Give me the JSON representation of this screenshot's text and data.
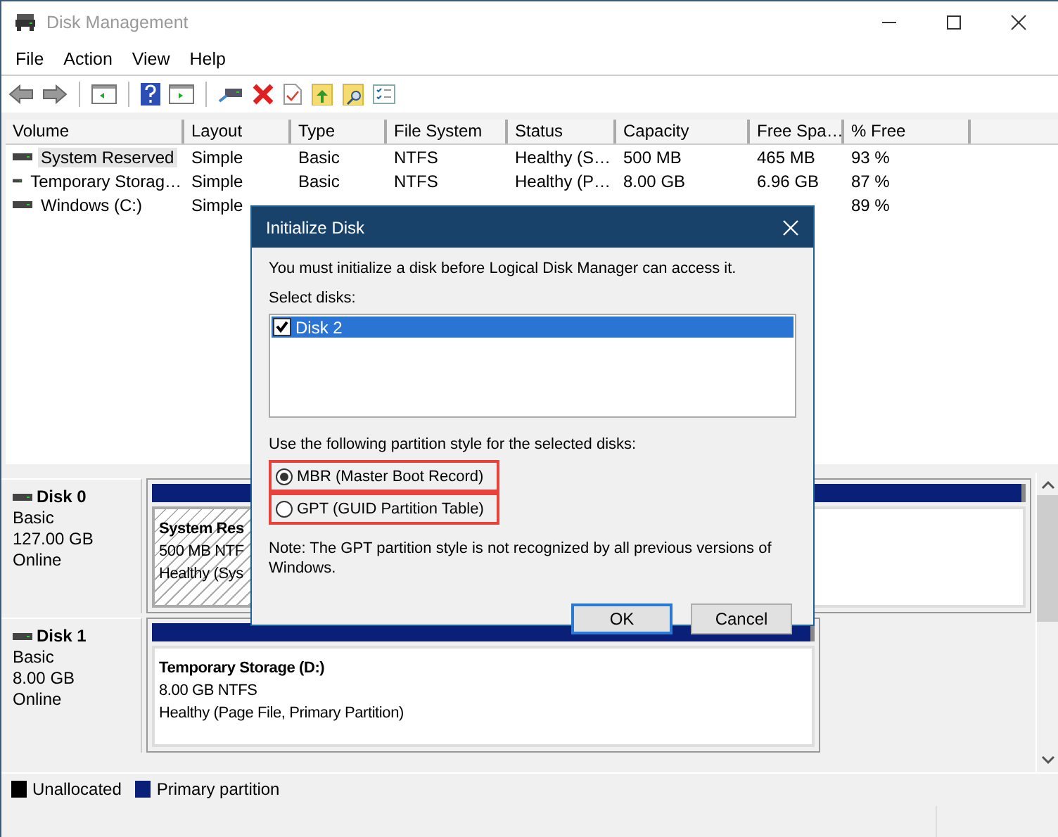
{
  "window": {
    "title": "Disk Management"
  },
  "menu": [
    "File",
    "Action",
    "View",
    "Help"
  ],
  "volume_table": {
    "columns": [
      "Volume",
      "Layout",
      "Type",
      "File System",
      "Status",
      "Capacity",
      "Free Spa…",
      "% Free"
    ],
    "rows": [
      {
        "selected": true,
        "volume": "System Reserved",
        "layout": "Simple",
        "type": "Basic",
        "file_system": "NTFS",
        "status": "Healthy (S…",
        "capacity": "500 MB",
        "free_space": "465 MB",
        "percent_free": "93 %"
      },
      {
        "selected": false,
        "volume": "Temporary Storag…",
        "layout": "Simple",
        "type": "Basic",
        "file_system": "NTFS",
        "status": "Healthy (P…",
        "capacity": "8.00 GB",
        "free_space": "6.96 GB",
        "percent_free": "87 %"
      },
      {
        "selected": false,
        "volume": "Windows (C:)",
        "layout": "Simple",
        "percent_free": "89 %"
      }
    ]
  },
  "disks": [
    {
      "name": "Disk 0",
      "type": "Basic",
      "size": "127.00 GB",
      "status": "Online",
      "partition": {
        "kind": "system",
        "title": "System Res",
        "detail": "500 MB NTF",
        "health": "Healthy (Sys"
      }
    },
    {
      "name": "Disk 1",
      "type": "Basic",
      "size": "8.00 GB",
      "status": "Online",
      "partition": {
        "kind": "primary",
        "title": "Temporary Storage  (D:)",
        "detail": "8.00 GB NTFS",
        "health": "Healthy (Page File, Primary Partition)"
      }
    }
  ],
  "legend": [
    {
      "label": "Unallocated",
      "color": "#000000"
    },
    {
      "label": "Primary partition",
      "color": "#0a1f78"
    }
  ],
  "dialog": {
    "title": "Initialize Disk",
    "message": "You must initialize a disk before Logical Disk Manager can access it.",
    "select_label": "Select disks:",
    "disks": [
      {
        "label": "Disk 2",
        "checked": true,
        "selected": true
      }
    ],
    "style_label": "Use the following partition style for the selected disks:",
    "styles": [
      {
        "label": "MBR (Master Boot Record)",
        "selected": true,
        "highlighted": true
      },
      {
        "label": "GPT (GUID Partition Table)",
        "selected": false,
        "highlighted": true
      }
    ],
    "note": "Note: The GPT partition style is not recognized by all previous versions of Windows.",
    "buttons": [
      {
        "label": "OK",
        "default": true
      },
      {
        "label": "Cancel",
        "default": false
      }
    ]
  }
}
